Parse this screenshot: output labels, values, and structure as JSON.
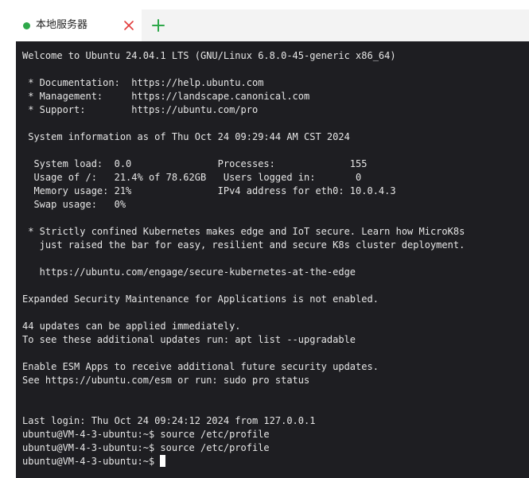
{
  "tab": {
    "title": "本地服务器",
    "status_color": "#2ea84a",
    "close_icon": "close-icon",
    "add_icon": "plus-icon"
  },
  "terminal": {
    "lines": [
      "Welcome to Ubuntu 24.04.1 LTS (GNU/Linux 6.8.0-45-generic x86_64)",
      "",
      " * Documentation:  https://help.ubuntu.com",
      " * Management:     https://landscape.canonical.com",
      " * Support:        https://ubuntu.com/pro",
      "",
      " System information as of Thu Oct 24 09:29:44 AM CST 2024",
      "",
      "  System load:  0.0               Processes:             155",
      "  Usage of /:   21.4% of 78.62GB   Users logged in:       0",
      "  Memory usage: 21%               IPv4 address for eth0: 10.0.4.3",
      "  Swap usage:   0%",
      "",
      " * Strictly confined Kubernetes makes edge and IoT secure. Learn how MicroK8s",
      "   just raised the bar for easy, resilient and secure K8s cluster deployment.",
      "",
      "   https://ubuntu.com/engage/secure-kubernetes-at-the-edge",
      "",
      "Expanded Security Maintenance for Applications is not enabled.",
      "",
      "44 updates can be applied immediately.",
      "To see these additional updates run: apt list --upgradable",
      "",
      "Enable ESM Apps to receive additional future security updates.",
      "See https://ubuntu.com/esm or run: sudo pro status",
      "",
      "",
      "Last login: Thu Oct 24 09:24:12 2024 from 127.0.0.1",
      "ubuntu@VM-4-3-ubuntu:~$ source /etc/profile",
      "ubuntu@VM-4-3-ubuntu:~$ source /etc/profile"
    ],
    "prompt": "ubuntu@VM-4-3-ubuntu:~$ "
  }
}
